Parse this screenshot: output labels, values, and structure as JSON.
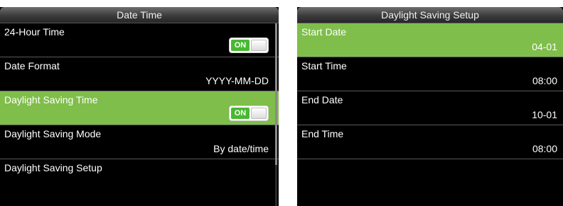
{
  "left": {
    "title": "Date Time",
    "items": [
      {
        "label": "24-Hour Time",
        "toggle": "ON"
      },
      {
        "label": "Date Format",
        "value": "YYYY-MM-DD"
      },
      {
        "label": "Daylight Saving Time",
        "toggle": "ON",
        "selected": true
      },
      {
        "label": "Daylight Saving Mode",
        "value": "By date/time"
      },
      {
        "label": "Daylight Saving Setup"
      }
    ]
  },
  "right": {
    "title": "Daylight Saving Setup",
    "items": [
      {
        "label": "Start Date",
        "value": "04-01",
        "selected": true
      },
      {
        "label": "Start Time",
        "value": "08:00"
      },
      {
        "label": "End Date",
        "value": "10-01"
      },
      {
        "label": "End Time",
        "value": "08:00"
      }
    ]
  },
  "colors": {
    "selected_row": "#7fbe4a",
    "toggle_on": "#49b832",
    "background": "#000000"
  }
}
